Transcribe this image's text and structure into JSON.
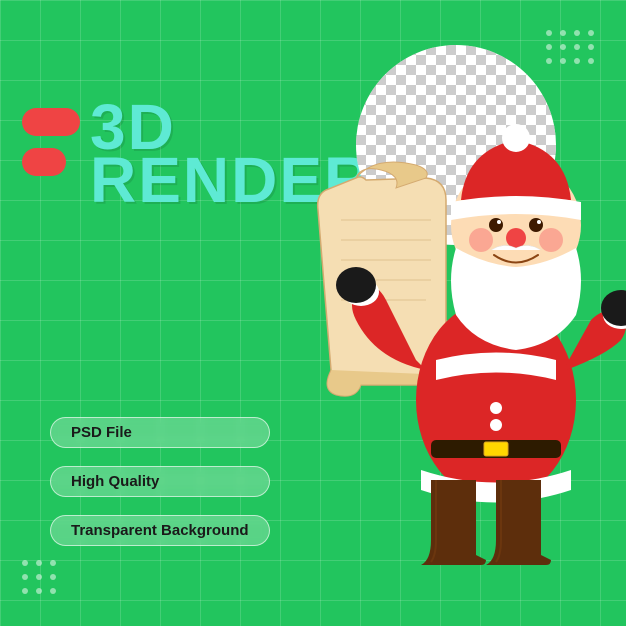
{
  "background_color": "#22C55E",
  "title": {
    "line1": "3D",
    "line2": "RENDER"
  },
  "badges": [
    {
      "label": "PSD File",
      "id": "psd-badge"
    },
    {
      "label": "High Quality",
      "id": "high-quality-badge"
    },
    {
      "label": "Transparent Background",
      "id": "transparent-badge"
    }
  ],
  "decorative": {
    "dots_count": 12,
    "checker_visible": true
  },
  "accent_color": "#EF4444",
  "text_color": "#5EEAD4"
}
